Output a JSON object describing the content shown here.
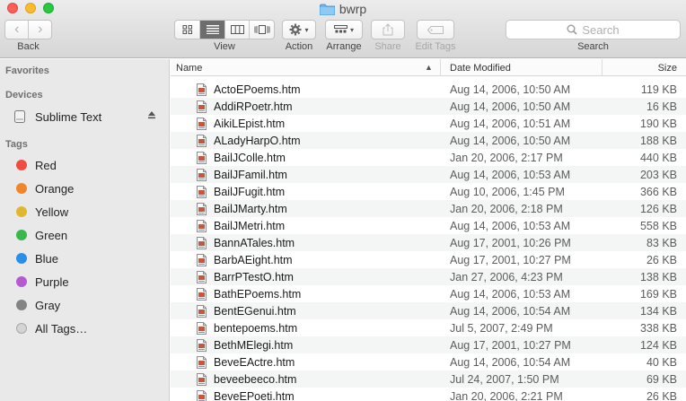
{
  "window": {
    "title": "bwrp"
  },
  "toolbar": {
    "back_label": "Back",
    "view_label": "View",
    "action_label": "Action",
    "arrange_label": "Arrange",
    "share_label": "Share",
    "edit_tags_label": "Edit Tags",
    "search_label": "Search",
    "search_placeholder": "Search"
  },
  "sidebar": {
    "favorites_heading": "Favorites",
    "devices_heading": "Devices",
    "device_name": "Sublime Text",
    "tags_heading": "Tags",
    "tags": [
      {
        "label": "Red",
        "color": "#f24b41"
      },
      {
        "label": "Orange",
        "color": "#f0852a"
      },
      {
        "label": "Yellow",
        "color": "#e1b730"
      },
      {
        "label": "Green",
        "color": "#37b84b"
      },
      {
        "label": "Blue",
        "color": "#2a8fe6"
      },
      {
        "label": "Purple",
        "color": "#b45bd2"
      },
      {
        "label": "Gray",
        "color": "#848484"
      },
      {
        "label": "All Tags…",
        "color": "#d4d4d4"
      }
    ]
  },
  "list": {
    "columns": {
      "name": "Name",
      "date": "Date Modified",
      "size": "Size"
    },
    "files": [
      {
        "name": "ActoEPoems.htm",
        "date": "Aug 14, 2006, 10:50 AM",
        "size": "119 KB"
      },
      {
        "name": "AddiRPoetr.htm",
        "date": "Aug 14, 2006, 10:50 AM",
        "size": "16 KB"
      },
      {
        "name": "AikiLEpist.htm",
        "date": "Aug 14, 2006, 10:51 AM",
        "size": "190 KB"
      },
      {
        "name": "ALadyHarpO.htm",
        "date": "Aug 14, 2006, 10:50 AM",
        "size": "188 KB"
      },
      {
        "name": "BailJColle.htm",
        "date": "Jan 20, 2006, 2:17 PM",
        "size": "440 KB"
      },
      {
        "name": "BailJFamil.htm",
        "date": "Aug 14, 2006, 10:53 AM",
        "size": "203 KB"
      },
      {
        "name": "BailJFugit.htm",
        "date": "Aug 10, 2006, 1:45 PM",
        "size": "366 KB"
      },
      {
        "name": "BailJMarty.htm",
        "date": "Jan 20, 2006, 2:18 PM",
        "size": "126 KB"
      },
      {
        "name": "BailJMetri.htm",
        "date": "Aug 14, 2006, 10:53 AM",
        "size": "558 KB"
      },
      {
        "name": "BannATales.htm",
        "date": "Aug 17, 2001, 10:26 PM",
        "size": "83 KB"
      },
      {
        "name": "BarbAEight.htm",
        "date": "Aug 17, 2001, 10:27 PM",
        "size": "26 KB"
      },
      {
        "name": "BarrPTestO.htm",
        "date": "Jan 27, 2006, 4:23 PM",
        "size": "138 KB"
      },
      {
        "name": "BathEPoems.htm",
        "date": "Aug 14, 2006, 10:53 AM",
        "size": "169 KB"
      },
      {
        "name": "BentEGenui.htm",
        "date": "Aug 14, 2006, 10:54 AM",
        "size": "134 KB"
      },
      {
        "name": "bentepoems.htm",
        "date": "Jul 5, 2007, 2:49 PM",
        "size": "338 KB"
      },
      {
        "name": "BethMElegi.htm",
        "date": "Aug 17, 2001, 10:27 PM",
        "size": "124 KB"
      },
      {
        "name": "BeveEActre.htm",
        "date": "Aug 14, 2006, 10:54 AM",
        "size": "40 KB"
      },
      {
        "name": "beveebeeco.htm",
        "date": "Jul 24, 2007, 1:50 PM",
        "size": "69 KB"
      },
      {
        "name": "BeveEPoeti.htm",
        "date": "Jan 20, 2006, 2:21 PM",
        "size": "26 KB"
      }
    ]
  }
}
